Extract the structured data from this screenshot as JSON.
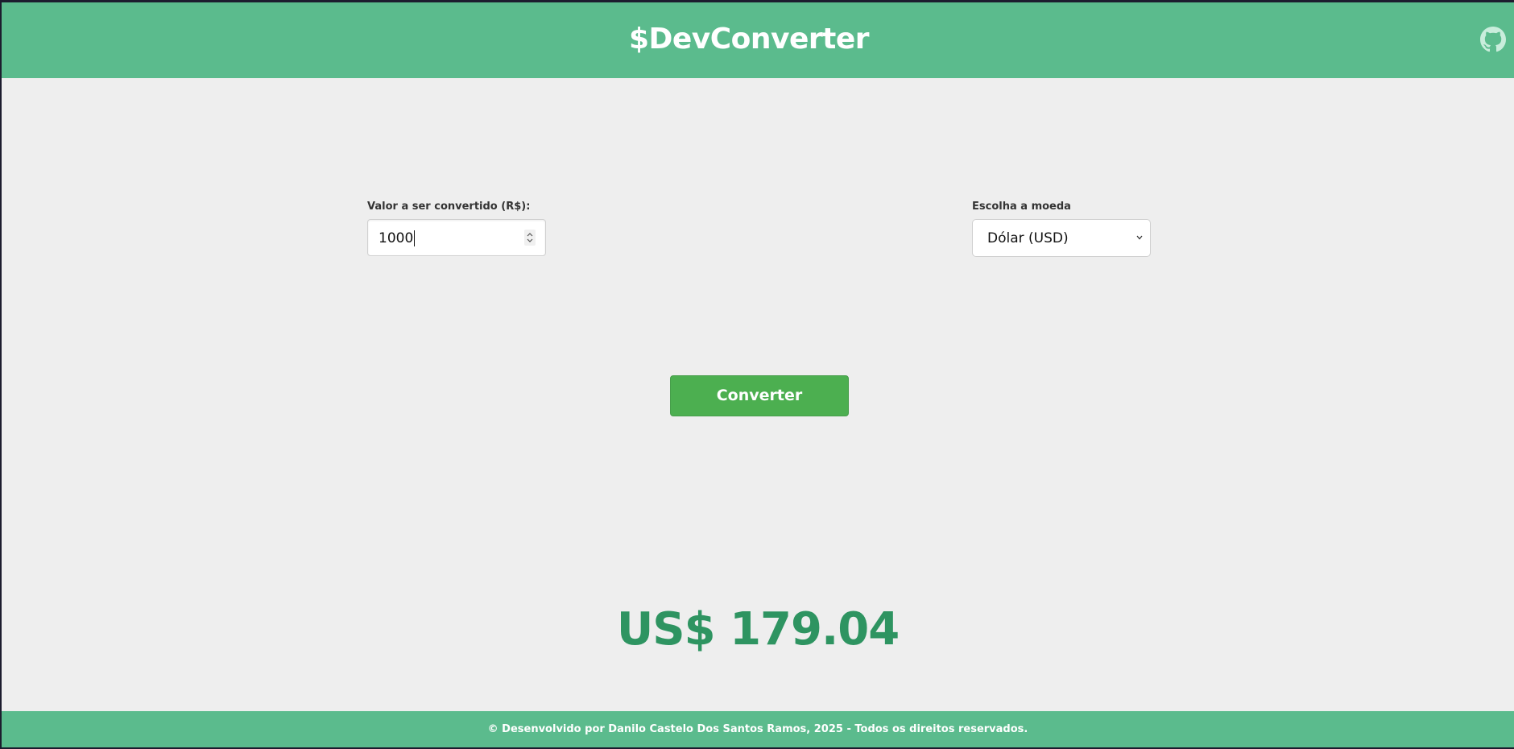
{
  "header": {
    "title": "$DevConverter",
    "github_icon": "github-icon"
  },
  "form": {
    "amount_label": "Valor a ser convertido (R$):",
    "amount_value": "1000",
    "currency_label": "Escolha a moeda",
    "currency_selected": "Dólar (USD)"
  },
  "actions": {
    "convert_label": "Converter"
  },
  "result": {
    "text": "US$ 179.04"
  },
  "footer": {
    "text": "© Desenvolvido por Danilo Castelo Dos Santos Ramos, 2025 - Todos os direitos reservados."
  },
  "colors": {
    "header_bg": "#5bbb8d",
    "button_bg": "#4caf50",
    "result_text": "#2e9461",
    "page_bg": "#eeeeee"
  }
}
